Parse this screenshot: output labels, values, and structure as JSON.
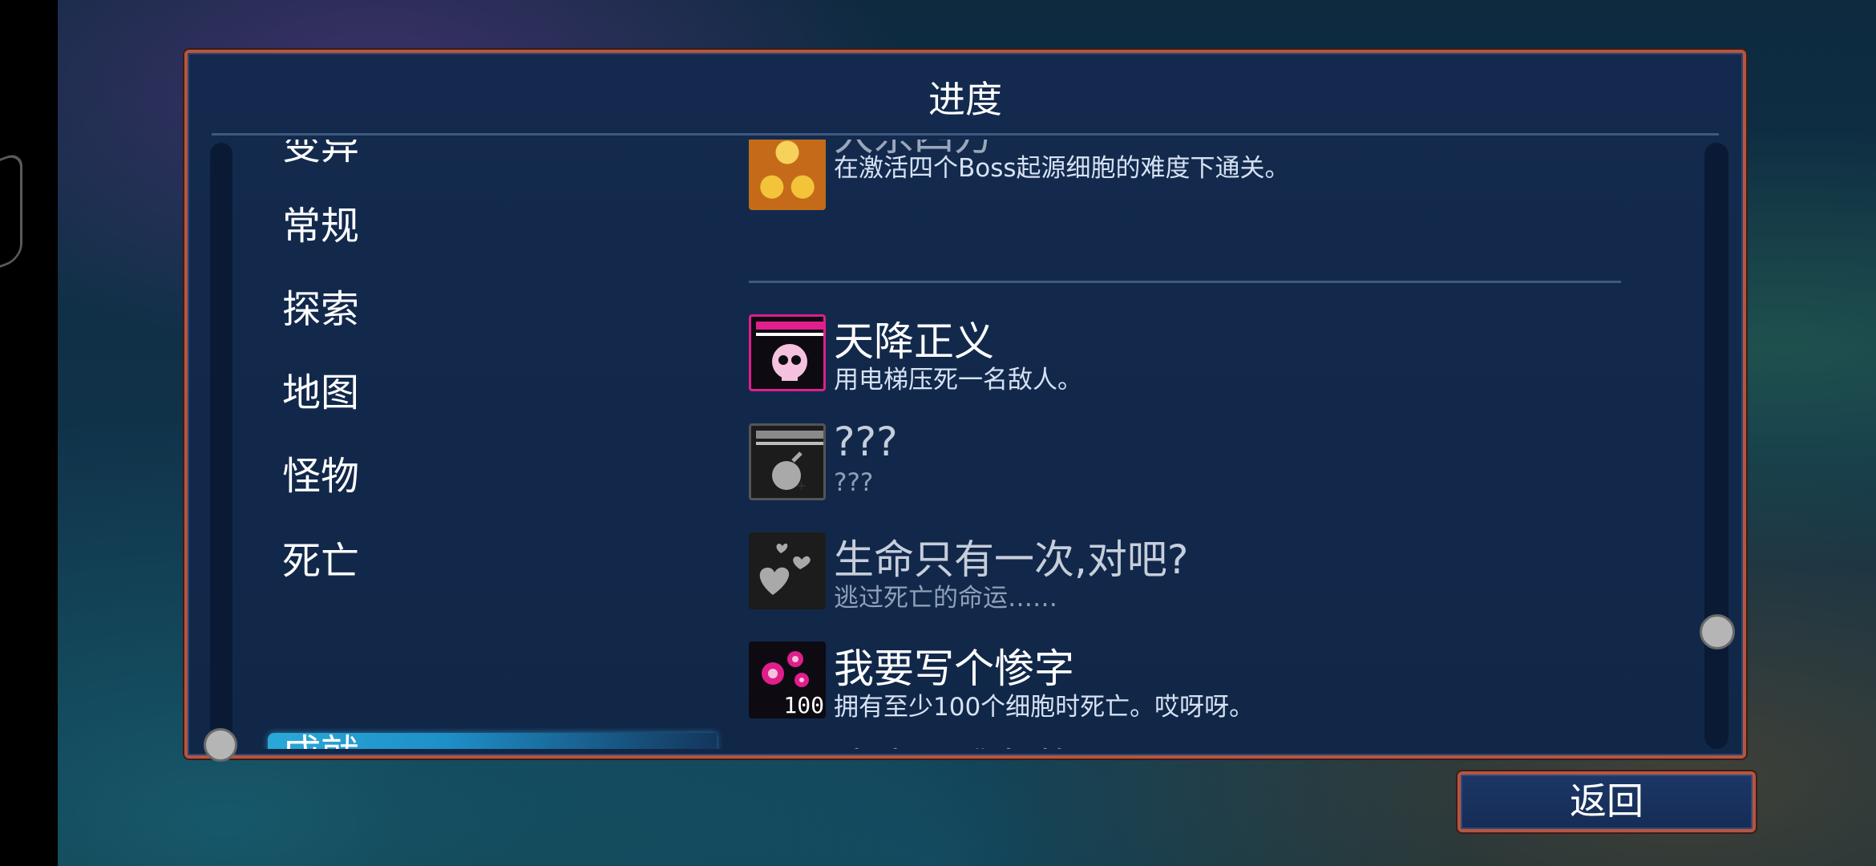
{
  "panel": {
    "title": "进度"
  },
  "menu": {
    "items": [
      {
        "label": "变异"
      },
      {
        "label": "常规"
      },
      {
        "label": "探索"
      },
      {
        "label": "地图"
      },
      {
        "label": "怪物"
      },
      {
        "label": "死亡"
      },
      {
        "label": "成就",
        "selected": true
      }
    ]
  },
  "achievements": [
    {
      "name": "大杀四方",
      "description": "在激活四个Boss起源细胞的难度下通关。",
      "icon": "gold-gear-icon",
      "unlocked": true
    },
    {
      "name": "天降正义",
      "description": "用电梯压死一名敌人。",
      "icon": "elevator-skull-icon",
      "unlocked": true
    },
    {
      "name": "???",
      "description": "???",
      "icon": "elevator-bomb-icon",
      "unlocked": false
    },
    {
      "name": "生命只有一次,对吧?",
      "description": "逃过死亡的命运……",
      "icon": "hearts-icon",
      "unlocked": false
    },
    {
      "name": "我要写个惨字",
      "description": "拥有至少100个细胞时死亡。哎呀呀。",
      "icon": "cells-100-icon",
      "icon_text": "100",
      "unlocked": true
    },
    {
      "name": "这也是难免的……",
      "description": "",
      "icon": "pink-bars-icon",
      "unlocked": true
    }
  ],
  "back_button": {
    "label": "返回"
  },
  "colors": {
    "panel_border": "#b8553e",
    "panel_bg": "#132a4e",
    "selected": "#29a9d8",
    "achievement_pink": "#e01e8c"
  }
}
